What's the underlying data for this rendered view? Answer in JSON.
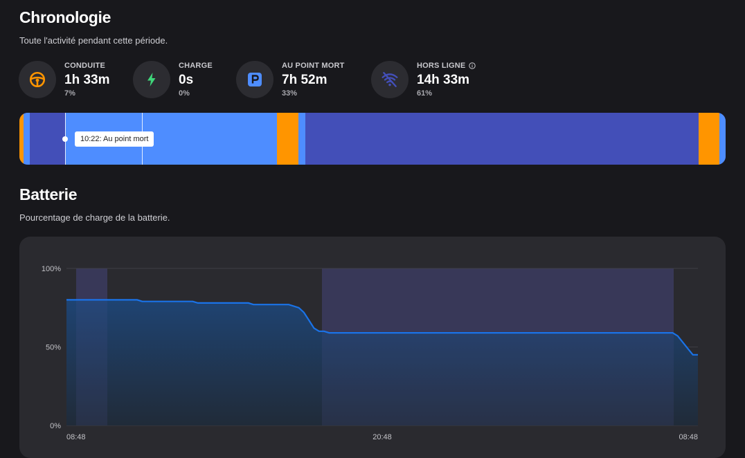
{
  "chronologie": {
    "title": "Chronologie",
    "subtitle": "Toute l'activité pendant cette période.",
    "stats": [
      {
        "label": "CONDUITE",
        "value": "1h 33m",
        "percent": "7%",
        "icon": "steering-wheel-icon",
        "color": "#ff9500"
      },
      {
        "label": "CHARGE",
        "value": "0s",
        "percent": "0%",
        "icon": "lightning-bolt-icon",
        "color": "#3fd67a"
      },
      {
        "label": "AU POINT MORT",
        "value": "7h 52m",
        "percent": "33%",
        "icon": "parking-icon",
        "color": "#4e8dff"
      },
      {
        "label": "HORS LIGNE",
        "value": "14h 33m",
        "percent": "61%",
        "icon": "wifi-off-icon",
        "color": "#434fb8",
        "info_icon": "info-icon"
      }
    ],
    "tooltip": "10:22: Au point mort"
  },
  "batterie": {
    "title": "Batterie",
    "subtitle": "Pourcentage de charge de la batterie."
  },
  "colors": {
    "conduite": "#ff9500",
    "point_mort": "#4e8dff",
    "hors_ligne": "#434fb8",
    "battery_line": "#1a73e8"
  },
  "chart_data": {
    "type": "area",
    "title": "",
    "xlabel": "",
    "ylabel": "",
    "ylim": [
      0,
      100
    ],
    "yticks": [
      "0%",
      "50%",
      "100%"
    ],
    "xticks": [
      "08:48",
      "20:48",
      "08:48"
    ],
    "grid": true,
    "series": [
      {
        "values_hours": [
          0,
          2.8,
          3.0,
          5.0,
          5.2,
          7.2,
          7.4,
          8.8,
          9.0,
          9.2,
          9.4,
          9.6,
          9.8,
          10.0,
          10.2,
          10.4,
          24.0,
          24.2,
          24.4,
          24.6,
          24.8,
          25.0
        ],
        "values": [
          80,
          80,
          79,
          79,
          78,
          78,
          77,
          77,
          76,
          75,
          72,
          67,
          62,
          60,
          60,
          59,
          59,
          57,
          53,
          49,
          45,
          45
        ]
      }
    ]
  }
}
